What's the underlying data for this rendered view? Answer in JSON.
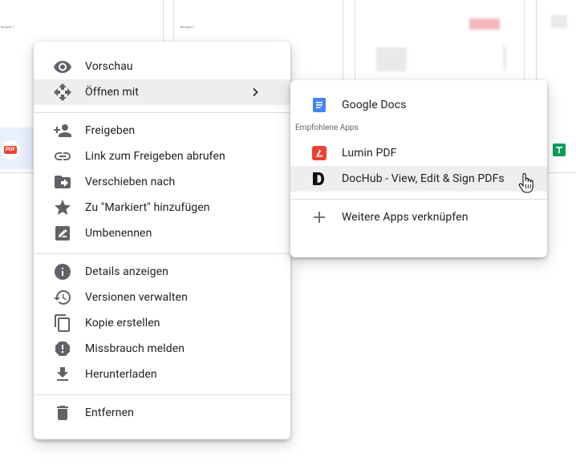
{
  "background": {
    "tiles": [
      {
        "thumb_text": "Beispiel 1"
      },
      {
        "thumb_text": "Beispiel 2"
      }
    ],
    "pdf_badge": "PDF"
  },
  "context_menu": {
    "items": [
      {
        "label": "Vorschau",
        "icon": "eye-icon"
      },
      {
        "label": "Öffnen mit",
        "icon": "move-arrows-icon"
      },
      {
        "label": "Freigeben",
        "icon": "person-add-icon"
      },
      {
        "label": "Link zum Freigeben abrufen",
        "icon": "link-icon"
      },
      {
        "label": "Verschieben nach",
        "icon": "folder-move-icon"
      },
      {
        "label": "Zu \"Markiert\" hinzufügen",
        "icon": "star-icon"
      },
      {
        "label": "Umbenennen",
        "icon": "rename-icon"
      },
      {
        "label": "Details anzeigen",
        "icon": "info-icon"
      },
      {
        "label": "Versionen verwalten",
        "icon": "history-icon"
      },
      {
        "label": "Kopie erstellen",
        "icon": "copy-icon"
      },
      {
        "label": "Missbrauch melden",
        "icon": "report-icon"
      },
      {
        "label": "Herunterladen",
        "icon": "download-icon"
      },
      {
        "label": "Entfernen",
        "icon": "trash-icon"
      }
    ]
  },
  "submenu": {
    "google_docs": "Google Docs",
    "recommended_label": "Empfohlene Apps",
    "lumin": "Lumin PDF",
    "dochub": "DocHub - View, Edit & Sign PDFs",
    "connect_more": "Weitere Apps verknüpfen"
  },
  "colors": {
    "icon_gray": "#5f6368",
    "docs_blue": "#4285f4",
    "lumin_red": "#ea4335",
    "sheets_green": "#0f9d58",
    "hover_bg": "#eeeeee"
  }
}
